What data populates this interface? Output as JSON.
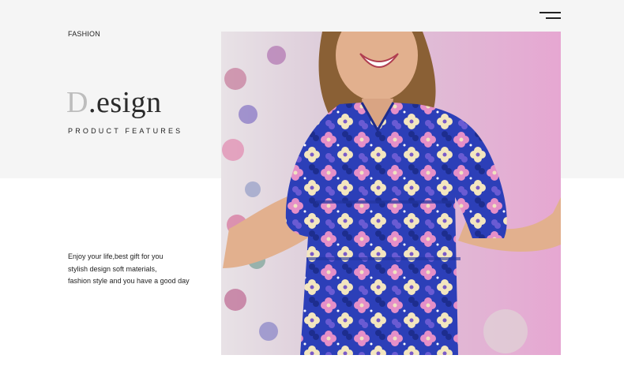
{
  "header": {
    "brand_label": "FASHION",
    "menu_icon": "hamburger-menu-icon"
  },
  "hero": {
    "title_initial": "D",
    "title_rest": ".esign",
    "subtitle": "PRODUCT FEATURES",
    "description": [
      "Enjoy your life,best gift for you",
      "stylish design soft materials,",
      "fashion style and you have a good day"
    ]
  },
  "photo": {
    "subject": "woman in blue floral dress",
    "dress_color": "#2c3fb8"
  },
  "colors": {
    "top_band": "#f5f5f5",
    "page_bg": "#ffffff",
    "text": "#222222",
    "initial_gray": "#bdbdbd"
  }
}
